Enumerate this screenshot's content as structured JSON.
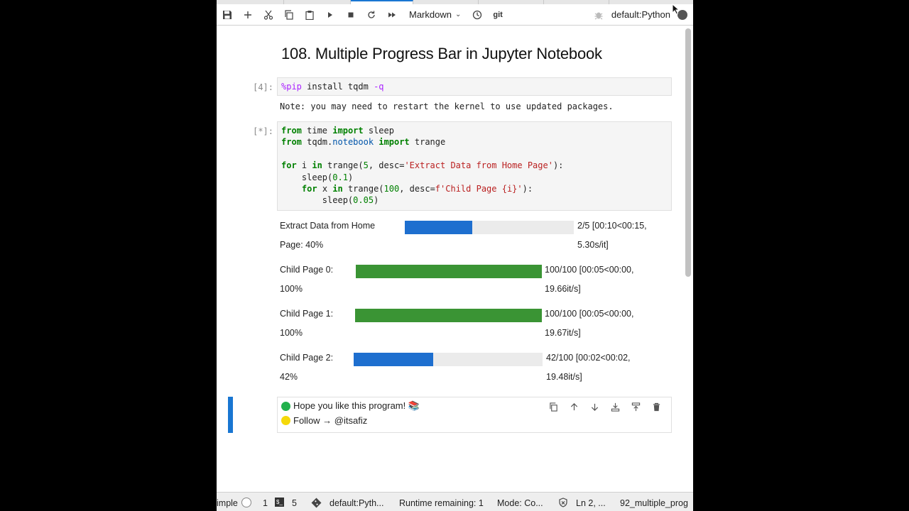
{
  "toolbar": {
    "cell_type": "Markdown",
    "git_label": "git",
    "kernel_name": "default:Python"
  },
  "notebook": {
    "heading": "108. Multiple Progress Bar in Jupyter Notebook",
    "cell1": {
      "prompt": "[4]:",
      "code_magic": "%pip",
      "code_rest": " install tqdm ",
      "code_flag": "-q",
      "output": "Note: you may need to restart the kernel to use updated packages."
    },
    "cell2": {
      "prompt": "[*]:",
      "lines": {
        "l1_kw1": "from",
        "l1_a": " time ",
        "l1_kw2": "import",
        "l1_b": " sleep",
        "l2_kw1": "from",
        "l2_a": " tqdm.",
        "l2_mod": "notebook",
        "l2_sp": " ",
        "l2_kw2": "import",
        "l2_b": " trange",
        "l4_kw1": "for",
        "l4_a": " i ",
        "l4_kw2": "in",
        "l4_b": " trange(",
        "l4_n": "5",
        "l4_c": ", desc=",
        "l4_s": "'Extract Data from Home Page'",
        "l4_d": "):",
        "l5_a": "    sleep(",
        "l5_n": "0.1",
        "l5_b": ")",
        "l6_ind": "    ",
        "l6_kw1": "for",
        "l6_a": " x ",
        "l6_kw2": "in",
        "l6_b": " trange(",
        "l6_n": "100",
        "l6_c": ", desc=",
        "l6_s": "f'Child Page {i}'",
        "l6_d": "):",
        "l7_a": "        sleep(",
        "l7_n": "0.05",
        "l7_b": ")"
      }
    },
    "progress_bars": [
      {
        "desc": "Extract Data from Home",
        "pct_line": "Page: 40%",
        "fraction": 0.4,
        "stat_line1": "2/5 [00:10<00:15,",
        "stat_line2": "5.30s/it]",
        "color": "#1e6fcf"
      },
      {
        "desc": "Child Page 0:",
        "pct_line": "100%",
        "fraction": 1.0,
        "stat_line1": "100/100 [00:05<00:00,",
        "stat_line2": "19.66it/s]",
        "color": "#3a9434"
      },
      {
        "desc": "Child Page 1:",
        "pct_line": "100%",
        "fraction": 1.0,
        "stat_line1": "100/100 [00:05<00:00,",
        "stat_line2": "19.67it/s]",
        "color": "#3a9434"
      },
      {
        "desc": "Child Page 2:",
        "pct_line": "42%",
        "fraction": 0.42,
        "stat_line1": "42/100 [00:02<00:02,",
        "stat_line2": "19.48it/s]",
        "color": "#1e6fcf"
      }
    ],
    "markdown_cell": {
      "line1": "Hope you like this program! 📚",
      "line2": "Follow → @itsafiz"
    }
  },
  "statusbar": {
    "mode_simple": "imple",
    "count1": "1",
    "count2": "5",
    "kernel": "default:Pyth...",
    "runtime": "Runtime remaining: 1",
    "mode": "Mode: Co...",
    "position": "Ln 2, ...",
    "filename": "92_multiple_prog"
  },
  "colors": {
    "accent": "#1976d2",
    "green_dot": "#22b14c",
    "yellow_dot": "#f5d90a"
  }
}
